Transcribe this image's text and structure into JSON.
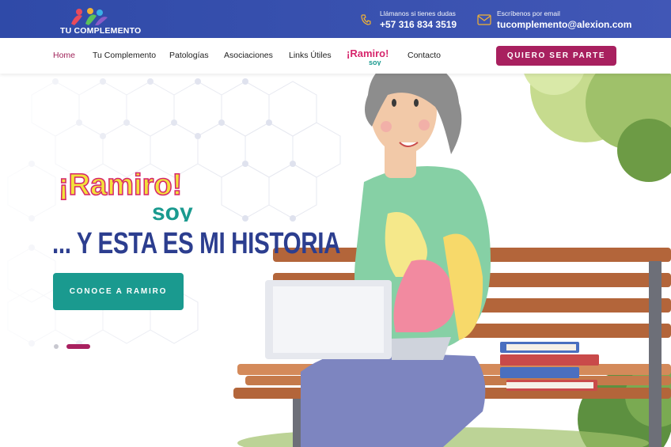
{
  "brand": {
    "name": "TU COMPLEMENTO"
  },
  "contact": {
    "phone_label": "Llámanos si tienes dudas",
    "phone": "+57 316 834 3519",
    "email_label": "Escríbenos por email",
    "email": "tucomplemento@alexion.com"
  },
  "nav": {
    "items": [
      "Home",
      "Tu Complemento",
      "Patologías",
      "Asociaciones",
      "Links Útiles",
      "Contacto"
    ],
    "logo_text_top": "¡Ramiro!",
    "logo_text_bottom": "soy",
    "cta": "QUIERO SER PARTE"
  },
  "hero": {
    "logo_top": "¡Ramiro!",
    "logo_bottom": "soy",
    "title": "... Y ESTA ES MI HISTORIA",
    "button": "CONOCE A RAMIRO",
    "slides_total": 2,
    "slide_active": 2
  },
  "colors": {
    "topbar": "#3a52b0",
    "accent": "#a8205f",
    "teal": "#1a9a8f",
    "title": "#2c3e8f"
  }
}
